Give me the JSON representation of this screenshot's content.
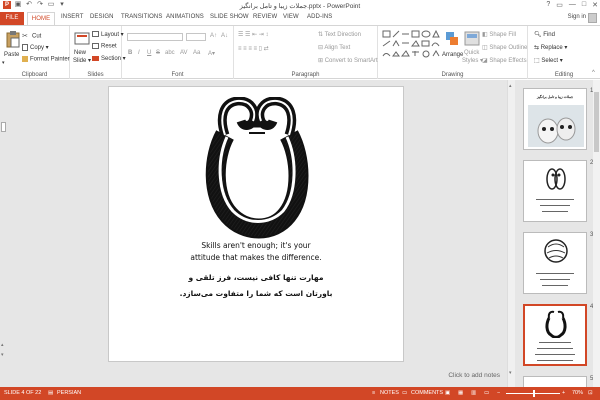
{
  "window": {
    "title": "جملات زیبا و تامل برانگیز.pptx - PowerPoint",
    "buttons": [
      "?",
      "▭",
      "—",
      "□",
      "✕"
    ]
  },
  "ribbon_tabs": [
    "FILE",
    "HOME",
    "INSERT",
    "DESIGN",
    "TRANSITIONS",
    "ANIMATIONS",
    "SLIDE SHOW",
    "REVIEW",
    "VIEW",
    "ADD-INS"
  ],
  "account": {
    "sign_in": "Sign in"
  },
  "clipboard": {
    "paste": "Paste",
    "cut": "Cut",
    "copy": "Copy",
    "format_painter": "Format Painter",
    "label": "Clipboard"
  },
  "slides_group": {
    "new_slide": "New",
    "new_slide2": "Slide",
    "layout": "Layout",
    "reset": "Reset",
    "section": "Section",
    "label": "Slides"
  },
  "font_group": {
    "bold": "B",
    "italic": "I",
    "underline": "U",
    "strike": "S",
    "shadow": "abc",
    "label": "Font"
  },
  "paragraph_group": {
    "text_direction": "Text Direction",
    "align_text": "Align Text",
    "convert_smartart": "Convert to SmartArt",
    "label": "Paragraph"
  },
  "drawing_group": {
    "arrange": "Arrange",
    "quick_styles": "Quick",
    "quick_styles2": "Styles",
    "shape_fill": "Shape Fill",
    "shape_outline": "Shape Outline",
    "shape_effects": "Shape Effects",
    "label": "Drawing"
  },
  "editing_group": {
    "find": "Find",
    "replace": "Replace",
    "select": "Select",
    "label": "Editing"
  },
  "slide": {
    "caption_en_1": "Skills aren't enough; it's your",
    "caption_en_2": "attitude that makes the difference.",
    "caption_fa_1": "مهارت تنها کافی نیست، فرز تلقی و",
    "caption_fa_2": "باورتان است که شما را متفاوت می‌سازد."
  },
  "notes_placeholder": "Click to add notes",
  "thumbnails": {
    "numbers": [
      "1",
      "2",
      "3",
      "4",
      "5"
    ],
    "t1_title": "جملات زیبا و تامل برانگیز"
  },
  "statusbar": {
    "slide_of": "SLIDE 4 OF 22",
    "language": "PERSIAN",
    "notes": "NOTES",
    "comments": "COMMENTS",
    "zoom": "70%"
  },
  "colors": {
    "accent": "#d24726"
  }
}
